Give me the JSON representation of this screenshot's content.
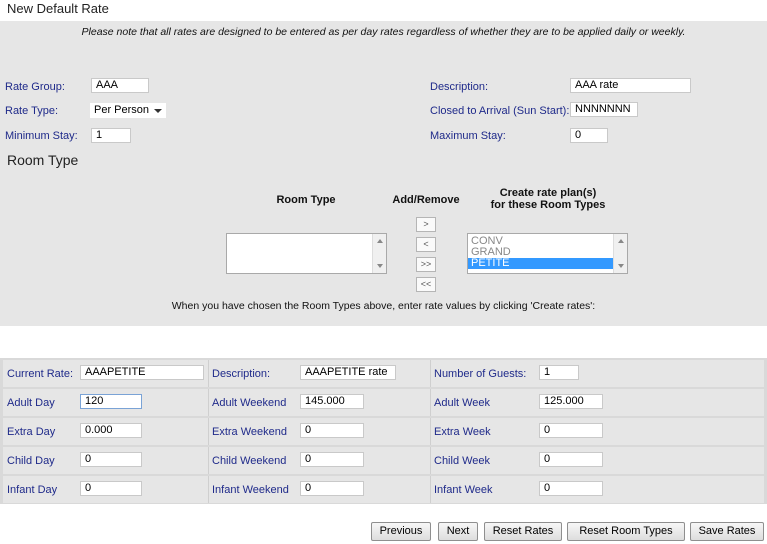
{
  "page_title": "New Default Rate",
  "note": "Please note that all rates are designed to be entered as per day rates regardless of whether they are to be applied daily or weekly.",
  "rate_form": {
    "rate_group_label": "Rate Group:",
    "rate_group_value": "AAA",
    "rate_type_label": "Rate Type:",
    "rate_type_value": "Per Person",
    "min_stay_label": "Minimum Stay:",
    "min_stay_value": "1",
    "description_label": "Description:",
    "description_value": "AAA rate",
    "closed_label": "Closed to Arrival (Sun Start):",
    "closed_value": "NNNNNNN",
    "max_stay_label": "Maximum Stay:",
    "max_stay_value": "0"
  },
  "room_type": {
    "section_title": "Room Type",
    "col_room_type": "Room Type",
    "col_add_remove": "Add/Remove",
    "col_create_line1": "Create rate plan(s)",
    "col_create_line2": "for these Room Types",
    "buttons": [
      ">",
      "<",
      ">>",
      "<<"
    ],
    "available": [],
    "selected": [
      {
        "label": "CONV",
        "selected": false
      },
      {
        "label": "GRAND",
        "selected": false
      },
      {
        "label": "PETITE",
        "selected": true
      }
    ],
    "instruction": "When you have chosen the Room Types above, enter rate values by clicking 'Create rates':"
  },
  "rates": {
    "current_rate_label": "Current Rate:",
    "current_rate_value": "AAAPETITE",
    "description_label": "Description:",
    "description_value": "AAAPETITE rate",
    "guests_label": "Number of Guests:",
    "guests_value": "1",
    "rows": [
      {
        "c1_label": "Adult Day",
        "c1_value": "120",
        "c2_label": "Adult Weekend",
        "c2_value": "145.000",
        "c3_label": "Adult Week",
        "c3_value": "125.000"
      },
      {
        "c1_label": "Extra Day",
        "c1_value": "0.000",
        "c2_label": "Extra Weekend",
        "c2_value": "0",
        "c3_label": "Extra Week",
        "c3_value": "0"
      },
      {
        "c1_label": "Child Day",
        "c1_value": "0",
        "c2_label": "Child Weekend",
        "c2_value": "0",
        "c3_label": "Child Week",
        "c3_value": "0"
      },
      {
        "c1_label": "Infant Day",
        "c1_value": "0",
        "c2_label": "Infant Weekend",
        "c2_value": "0",
        "c3_label": "Infant Week",
        "c3_value": "0"
      }
    ]
  },
  "actions": {
    "previous": "Previous",
    "next": "Next",
    "reset_rates": "Reset Rates",
    "reset_room_types": "Reset Room Types",
    "save_rates": "Save Rates"
  }
}
